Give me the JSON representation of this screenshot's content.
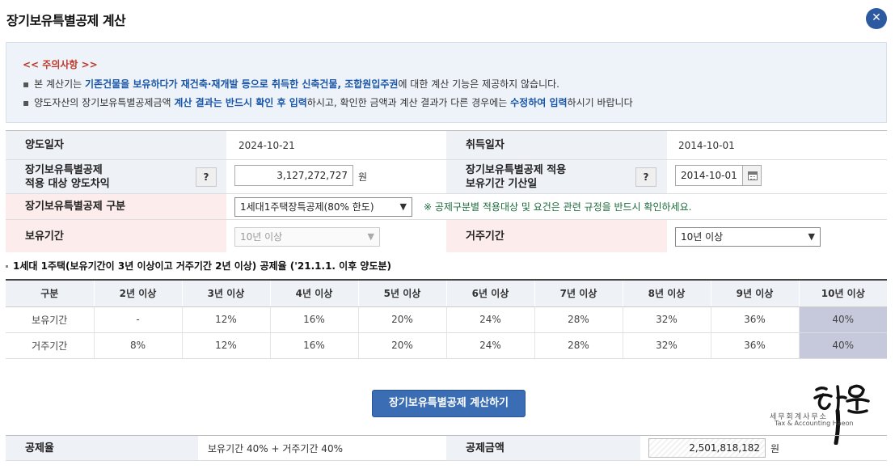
{
  "window": {
    "title": "장기보유특별공제 계산",
    "close_label": "✕"
  },
  "notice": {
    "title": "<< 주의사항 >>",
    "line1": {
      "bullet": "▪",
      "a": "본 계산기는 ",
      "b": "기존건물을 보유하다가 재건축·재개발 등으로 취득한 신축건물, 조합원입주권",
      "c": "에 대한 계산 기능은 제공하지 않습니다."
    },
    "line2": {
      "bullet": "▪",
      "a": "양도자산의 장기보유특별공제금액 ",
      "b": "계산 결과는 반드시 확인 후 입력",
      "c": "하시고, 확인한 금액과 계산 결과가 다른 경우에는 ",
      "d": "수정하여 입력",
      "e": "하시기 바랍니다"
    }
  },
  "form": {
    "transfer_date_label": "양도일자",
    "transfer_date": "2024-10-21",
    "acquisition_date_label": "취득일자",
    "acquisition_date": "2014-10-01",
    "gain_label": "장기보유특별공제\n적용 대상 양도차익",
    "help_label": "?",
    "gain_value": "3,127,272,727",
    "won": "원",
    "period_start_label": "장기보유특별공제 적용\n보유기간 기산일",
    "period_start_value": "2014-10-01",
    "type_label": "장기보유특별공제 구분",
    "type_selected": "1세대1주택장특공제(80% 한도)",
    "type_note": "※ 공제구분별 적용대상 및 요건은 관련 규정을 반드시 확인하세요.",
    "holding_label": "보유기간",
    "holding_selected": "10년 이상",
    "residence_label": "거주기간",
    "residence_selected": "10년 이상"
  },
  "rate_table": {
    "heading": "1세대 1주택(보유기간이 3년 이상이고 거주기간 2년 이상) 공제율 ('21.1.1. 이후 양도분)",
    "headers": [
      "구분",
      "2년 이상",
      "3년 이상",
      "4년 이상",
      "5년 이상",
      "6년 이상",
      "7년 이상",
      "8년 이상",
      "9년 이상",
      "10년 이상"
    ],
    "rows": [
      [
        "보유기간",
        "-",
        "12%",
        "16%",
        "20%",
        "24%",
        "28%",
        "32%",
        "36%",
        "40%"
      ],
      [
        "거주기간",
        "8%",
        "12%",
        "16%",
        "20%",
        "24%",
        "28%",
        "32%",
        "36%",
        "40%"
      ]
    ]
  },
  "calc_button": "장기보유특별공제 계산하기",
  "logo": {
    "name": "해온",
    "sub": "세무회계사무소",
    "sub_en": "Tax & Accounting Haeon"
  },
  "result": {
    "rate_label": "공제율",
    "rate_value": "보유기간 40% + 거주기간 40%",
    "amount_label": "공제금액",
    "amount_value": "2,501,818,182",
    "won": "원"
  },
  "colors": {
    "accent": "#2c5aa0",
    "highlight_cell": "#c5c9db",
    "notice_title": "#c0392b",
    "notice_highlight": "#1a56a8"
  }
}
